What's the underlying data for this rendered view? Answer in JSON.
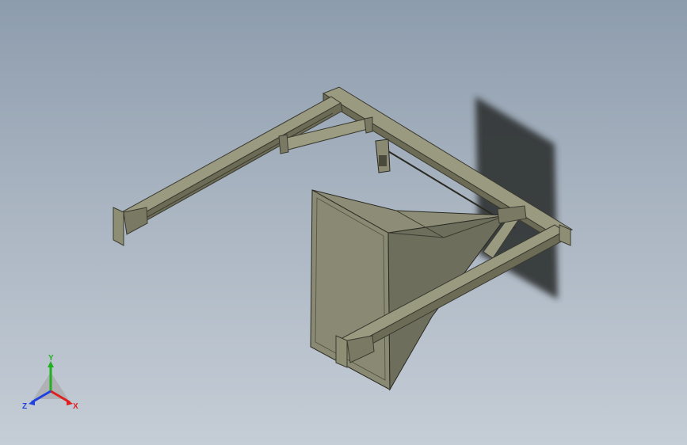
{
  "viewport": {
    "background_top": "#8d9cad",
    "background_bottom": "#c5cdd6"
  },
  "model": {
    "steel_color": "#87876e",
    "steel_dark": "#5f5f4d",
    "hopper_color": "#7f7f6b",
    "wall_shadow_color": "#2e3033"
  },
  "triad": {
    "x_label": "X",
    "y_label": "Y",
    "z_label": "Z",
    "x_color": "#e02020",
    "y_color": "#20b020",
    "z_color": "#2040e0"
  }
}
